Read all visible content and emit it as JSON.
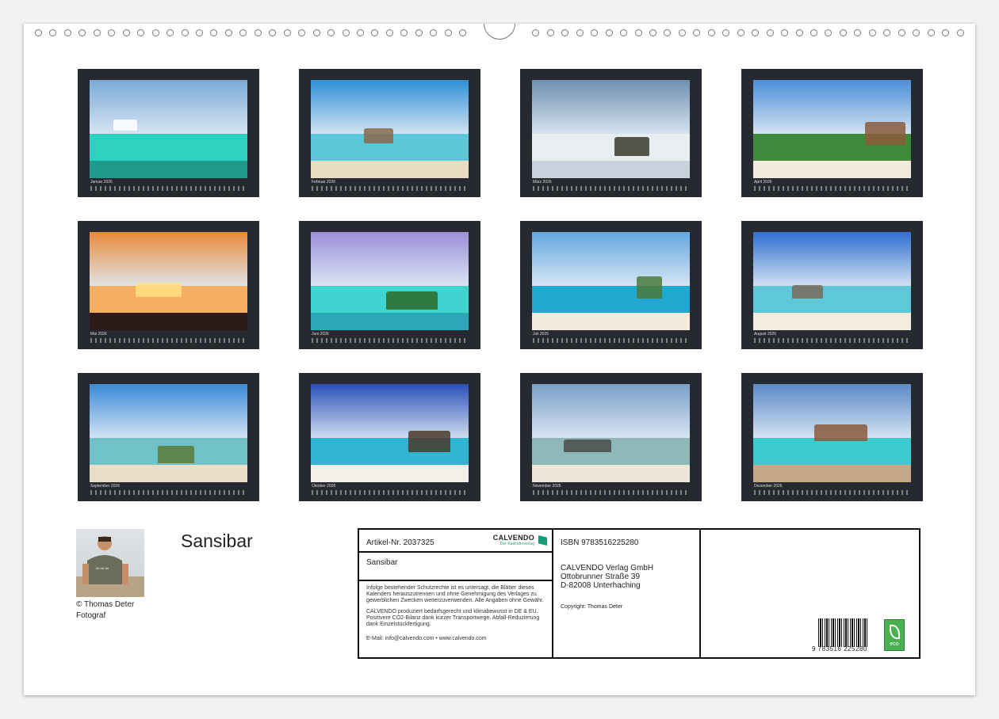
{
  "calendar": {
    "title": "Sansibar",
    "months": [
      {
        "label": "Januar 2026",
        "sky": "#7aa9d8",
        "sea": "#2ed0c0",
        "sand": "#1f9a8a",
        "accent": "#ffffff"
      },
      {
        "label": "Februar 2026",
        "sky": "#2f8fd6",
        "sea": "#5cc7d8",
        "sand": "#e9dcc0",
        "accent": "#8a6a4a"
      },
      {
        "label": "März 2026",
        "sky": "#6f8fb0",
        "sea": "#e8edf2",
        "sand": "#c9d3dd",
        "accent": "#3a3a30"
      },
      {
        "label": "April 2026",
        "sky": "#4a8fd8",
        "sea": "#3e8a3a",
        "sand": "#f0eadf",
        "accent": "#8b5a3a"
      },
      {
        "label": "Mai 2026",
        "sky": "#e88a3a",
        "sea": "#f4b060",
        "sand": "#2a1a18",
        "accent": "#ffe080"
      },
      {
        "label": "Juni 2026",
        "sky": "#9c8fd8",
        "sea": "#3fd4d0",
        "sand": "#2aa8b8",
        "accent": "#2a6a2a"
      },
      {
        "label": "Juli 2026",
        "sky": "#64a8e0",
        "sea": "#22a8d0",
        "sand": "#f3eadb",
        "accent": "#4a7a3a"
      },
      {
        "label": "August 2026",
        "sky": "#2f6fd0",
        "sea": "#5fc8d8",
        "sand": "#f2ecdf",
        "accent": "#7a6a5a"
      },
      {
        "label": "September 2026",
        "sky": "#3a8ad8",
        "sea": "#6ec2c8",
        "sand": "#e9dfc8",
        "accent": "#5a7a3a"
      },
      {
        "label": "Oktober 2026",
        "sky": "#2a4fb8",
        "sea": "#2fb5d0",
        "sand": "#f3efe6",
        "accent": "#4a3a2a"
      },
      {
        "label": "November 2026",
        "sky": "#7a9fc8",
        "sea": "#8fb8b8",
        "sand": "#ece6da",
        "accent": "#4a4a4a"
      },
      {
        "label": "Dezember 2026",
        "sky": "#5a8ac8",
        "sea": "#3ec8d0",
        "sand": "#c8a888",
        "accent": "#8a5a3a"
      }
    ]
  },
  "author": {
    "credit": "© Thomas Deter",
    "role": "Fotograf"
  },
  "info": {
    "article": "Artikel-Nr. 2037325",
    "brand": "CALVENDO",
    "brand_sub": "Der Kalenderverlag",
    "name": "Sansibar",
    "legal1": "Infolge bestehender Schutzrechte ist es untersagt, die Blätter dieses Kalenders herauszutrennen und ohne Genehmigung des Verlages zu gewerblichen Zwecken weiterzuverwenden. Alle Angaben ohne Gewähr.",
    "legal2": "CALVENDO produziert bedarfsgerecht und klimabewusst in DE & EU. Positivere CO2-Bilanz dank kurzer Transportwege. Abfall-Reduzierung dank Einzelstückfertigung.",
    "email": "E-Mail: info@calvendo.com • www.calvendo.com",
    "isbn": "ISBN 9783516225280",
    "publisher1": "CALVENDO Verlag GmbH",
    "publisher2": "Ottobrunner Straße 39",
    "publisher3": "D-82008 Unterhaching",
    "copyright": "Copyright: Thomas Deter",
    "barcode_number": "9 783516 225280",
    "eco_label": "eco"
  }
}
